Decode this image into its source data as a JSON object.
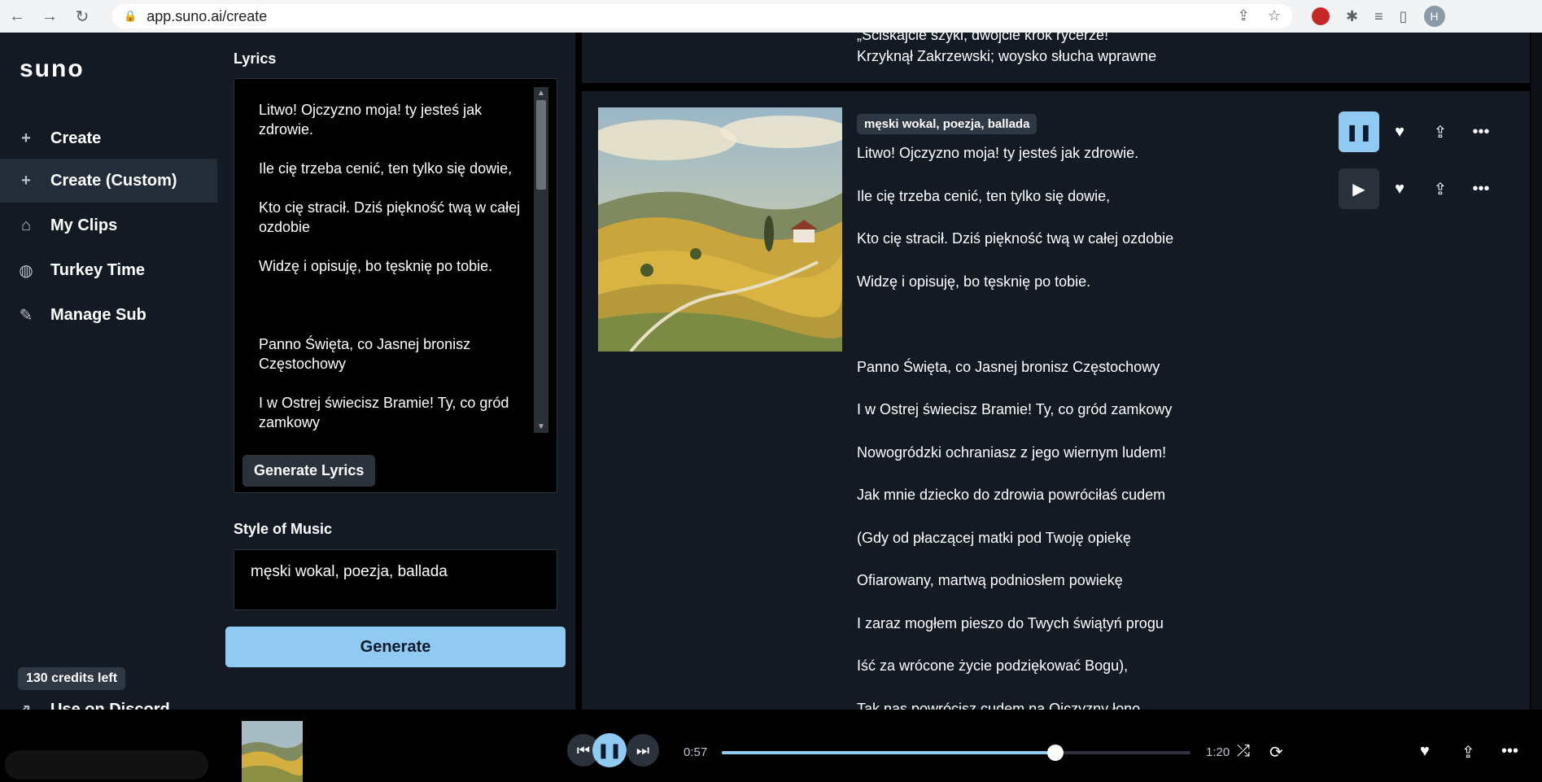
{
  "browser": {
    "url": "app.suno.ai/create",
    "profile_initial": "H"
  },
  "sidebar": {
    "logo": "suno",
    "items": [
      {
        "label": "Create",
        "icon": "plus-icon"
      },
      {
        "label": "Create (Custom)",
        "icon": "plus-icon"
      },
      {
        "label": "My Clips",
        "icon": "home-icon"
      },
      {
        "label": "Turkey Time",
        "icon": "globe-icon"
      },
      {
        "label": "Manage Sub",
        "icon": "edit-icon"
      }
    ],
    "credits": "130 credits left",
    "discord": "Use on Discord"
  },
  "form": {
    "lyrics_label": "Lyrics",
    "lyrics_value": "Litwo! Ojczyzno moja! ty jesteś jak\nzdrowie.\n\nIle cię trzeba cenić, ten tylko się dowie,\n\nKto cię stracił. Dziś piękność twą w całej\nozdobie\n\nWidzę i opisuję, bo tęsknię po tobie.\n\n\n\nPanno Święta, co Jasnej bronisz\nCzęstochowy\n\nI w Ostrej świecisz Bramie! Ty, co gród\nzamkowy\n\nNowogródzki ochraniasz z jego wiernym ludem!",
    "generate_lyrics": "Generate Lyrics",
    "style_label": "Style of Music",
    "style_value": "męski wokal, poezja, ballada",
    "generate": "Generate"
  },
  "top_card": {
    "line1": "„Ściskajcie szyki, dwójcie krok rycerze!",
    "line2": "Krzyknął Zakrzewski; woysko słucha wprawne"
  },
  "song_card": {
    "tag": "męski wokal, poezja, ballada",
    "lyrics": [
      "Litwo! Ojczyzno moja! ty jesteś jak zdrowie.",
      "Ile cię trzeba cenić, ten tylko się dowie,",
      "Kto cię stracił. Dziś piękność twą w całej ozdobie",
      "Widzę i opisuję, bo tęsknię po tobie.",
      "",
      "Panno Święta, co Jasnej bronisz Częstochowy",
      "I w Ostrej świecisz Bramie! Ty, co gród zamkowy",
      "Nowogródzki ochraniasz z jego wiernym ludem!",
      "Jak mnie dziecko do zdrowia powróciłaś cudem",
      "(Gdy od płaczącej matki pod Twoję opiekę",
      "Ofiarowany, martwą podniosłem powiekę",
      "I zaraz mogłem pieszo do Twych świątyń progu",
      "Iść za wrócone życie podziękować Bogu),",
      "Tak nas powrócisz cudem na Ojczyzny łono"
    ]
  },
  "player": {
    "current": "0:57",
    "total": "1:20",
    "progress": 0.7125
  },
  "colors": {
    "accent": "#90caf3",
    "panel": "#131a24",
    "active_nav": "#232c39"
  }
}
